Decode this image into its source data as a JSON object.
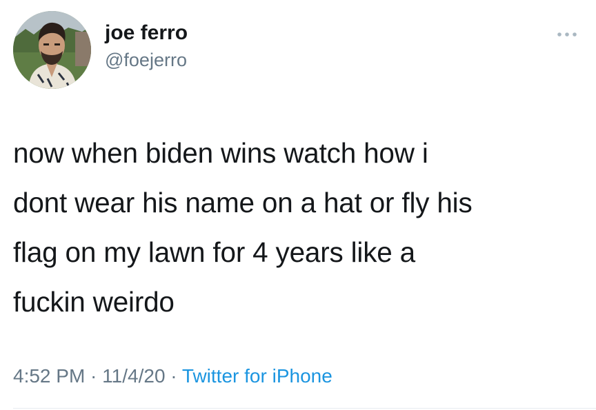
{
  "tweet": {
    "author": {
      "display_name": "joe ferro",
      "handle": "@foejerro"
    },
    "more_icon": "more-dots-icon",
    "text_lines": [
      "now when biden wins watch how i",
      "dont wear his name on a hat or fly his",
      "flag on my lawn for 4 years like a",
      "fuckin weirdo"
    ],
    "meta": {
      "time": "4:52 PM",
      "separator": " · ",
      "date": "11/4/20",
      "source": "Twitter for iPhone"
    }
  },
  "colors": {
    "text": "#14171a",
    "secondary": "#657786",
    "link": "#1b95e0",
    "divider": "#e6ecf0"
  }
}
